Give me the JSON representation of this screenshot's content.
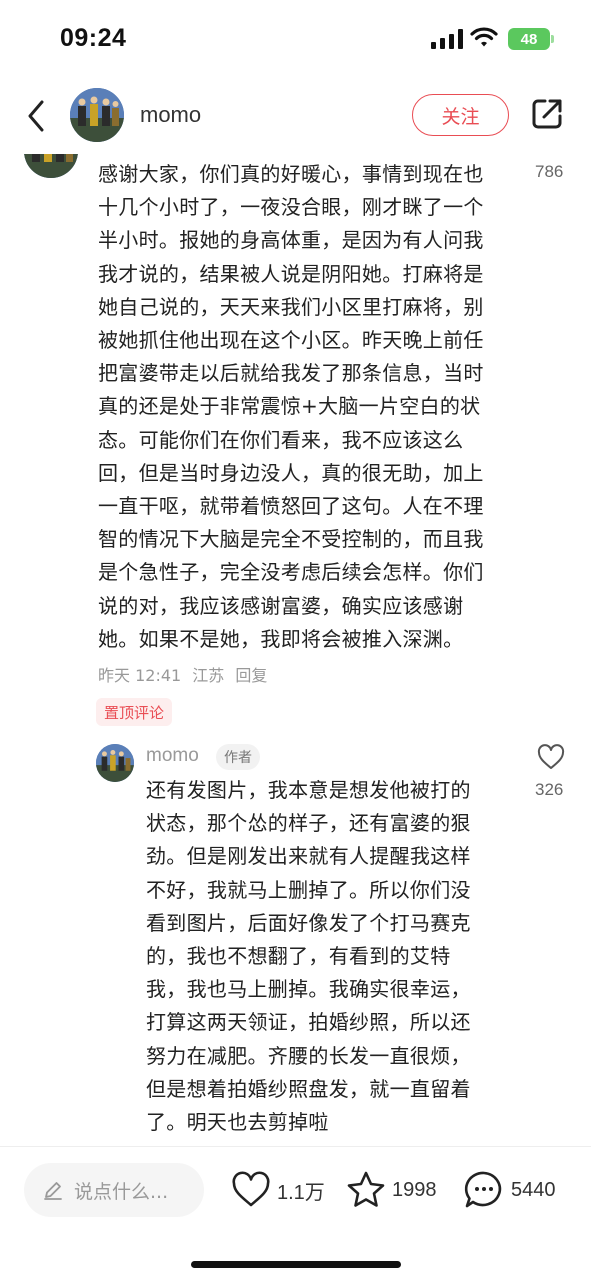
{
  "status_bar": {
    "time": "09:24",
    "battery": "48",
    "icons": [
      "signal-icon",
      "wifi-icon",
      "battery-icon"
    ]
  },
  "nav": {
    "username": "momo",
    "follow_label": "关注",
    "icons": [
      "back-icon",
      "share-icon"
    ]
  },
  "main_comment": {
    "lines": [
      "感谢大家，你们真的好暖心，事情到现在也",
      "十几个小时了，一夜没合眼，刚才眯了一个",
      "半小时。报她的身高体重，是因为有人问我",
      "我才说的，结果被人说是阴阳她。打麻将是",
      "她自己说的，天天来我们小区里打麻将，别",
      "被她抓住他出现在这个小区。昨天晚上前任",
      "把富婆带走以后就给我发了那条信息，当时",
      "真的还是处于非常震惊+大脑一片空白的状",
      "态。可能你们在你们看来，我不应该这么",
      "回，但是当时身边没人，真的很无助，加上",
      "一直干呕，就带着愤怒回了这句。人在不理",
      "智的情况下大脑是完全不受控制的，而且我",
      "是个急性子，完全没考虑后续会怎样。你们",
      "说的对，我应该感谢富婆，确实应该感谢",
      "她。如果不是她，我即将会被推入深渊。"
    ],
    "likes": "786",
    "time": "昨天 12:41",
    "location": "江苏",
    "reply_label": "回复",
    "pinned_label": "置顶评论"
  },
  "reply_comment": {
    "username": "momo",
    "author_badge": "作者",
    "likes": "326",
    "lines": [
      "还有发图片，我本意是想发他被打的",
      "状态，那个怂的样子，还有富婆的狠",
      "劲。但是刚发出来就有人提醒我这样",
      "不好，我就马上删掉了。所以你们没",
      "看到图片，后面好像发了个打马赛克",
      "的，我也不想翻了，有看到的艾特",
      "我，我也马上删掉。我确实很幸运，",
      "打算这两天领证，拍婚纱照，所以还",
      "努力在减肥。齐腰的长发一直很烦，",
      "但是想着拍婚纱照盘发，就一直留着",
      "了。明天也去剪掉啦"
    ]
  },
  "bottom_bar": {
    "input_placeholder": "说点什么...",
    "likes": "1.1万",
    "favorites": "1998",
    "comments": "5440",
    "icons": [
      "pencil-icon",
      "heart-icon",
      "star-icon",
      "comment-icon"
    ]
  },
  "colors": {
    "accent": "#e94d54",
    "battery": "#5bc85e",
    "muted_text": "#999999"
  }
}
